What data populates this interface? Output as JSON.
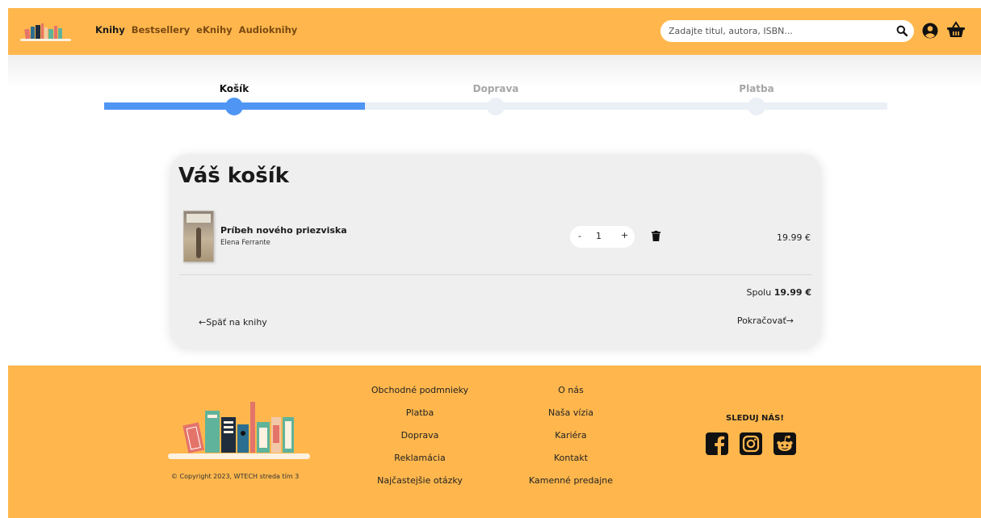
{
  "header": {
    "nav": [
      "Knihy",
      "Bestsellery",
      "eKnihy",
      "Audioknihy"
    ],
    "search_placeholder": "Zadajte titul, autora, ISBN...",
    "icons": [
      "search-icon",
      "user-icon",
      "cart-icon"
    ],
    "bg_color": "#ffb74d"
  },
  "steps": [
    {
      "label": "Košík",
      "state": "done"
    },
    {
      "label": "Doprava",
      "state": "todo"
    },
    {
      "label": "Platba",
      "state": "todo"
    }
  ],
  "progress": {
    "active_step": 1,
    "total_steps": 3,
    "fill_color": "#4f95f3"
  },
  "cart": {
    "title": "Váš košík",
    "items": [
      {
        "title": "Príbeh nového priezviska",
        "author": "Elena Ferrante",
        "quantity": "1",
        "minus": "-",
        "plus": "+",
        "price": "19.99 €"
      }
    ],
    "total_label": "Spolu",
    "total_value": "19.99 €",
    "back_label": "←Späť na knihy",
    "next_label": "Pokračovať→"
  },
  "footer": {
    "copyright": "© Copyright 2023, WTECH streda tím 3",
    "col1": [
      "Obchodné podmnieky",
      "Platba",
      "Doprava",
      "Reklamácia",
      "Najčastejšie otázky"
    ],
    "col2": [
      "O nás",
      "Naša vízia",
      "Kariéra",
      "Kontakt",
      "Kamenné predajne"
    ],
    "follow_label": "SLEDUJ NÁS!",
    "social": [
      "facebook-icon",
      "instagram-icon",
      "reddit-icon"
    ]
  }
}
